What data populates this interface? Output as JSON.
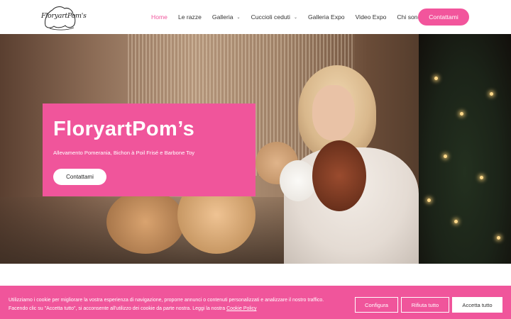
{
  "brand": {
    "logo_text": "FloryartPom's"
  },
  "nav": {
    "items": [
      {
        "label": "Home",
        "active": true,
        "dropdown": false
      },
      {
        "label": "Le razze",
        "active": false,
        "dropdown": false
      },
      {
        "label": "Galleria",
        "active": false,
        "dropdown": true
      },
      {
        "label": "Cuccioli ceduti",
        "active": false,
        "dropdown": true
      },
      {
        "label": "Galleria Expo",
        "active": false,
        "dropdown": false
      },
      {
        "label": "Video Expo",
        "active": false,
        "dropdown": false
      },
      {
        "label": "Chi sono",
        "active": false,
        "dropdown": false
      }
    ],
    "cta_label": "Contattami"
  },
  "hero": {
    "title": "FloryartPom’s",
    "subtitle": "Allevamento Pomerania, Bichon à Poil Frisé e Barbone Toy",
    "button_label": "Contattami"
  },
  "cookie_banner": {
    "line1": "Utilizziamo i cookie per migliorare la vostra esperienza di navigazione, proporre annunci o contenuti personalizzati e analizzare il nostro traffico.",
    "line2": "Facendo clic su \"Accetta tutto\", si acconsente all'utilizzo dei cookie da parte nostra. Leggi la nostra ",
    "policy_link": "Cookie Policy",
    "configure_label": "Configura",
    "reject_label": "Rifiuta tutto",
    "accept_label": "Accetta tutto"
  },
  "colors": {
    "accent": "#f0559b",
    "active_nav": "#f0569d",
    "text": "#333333"
  }
}
